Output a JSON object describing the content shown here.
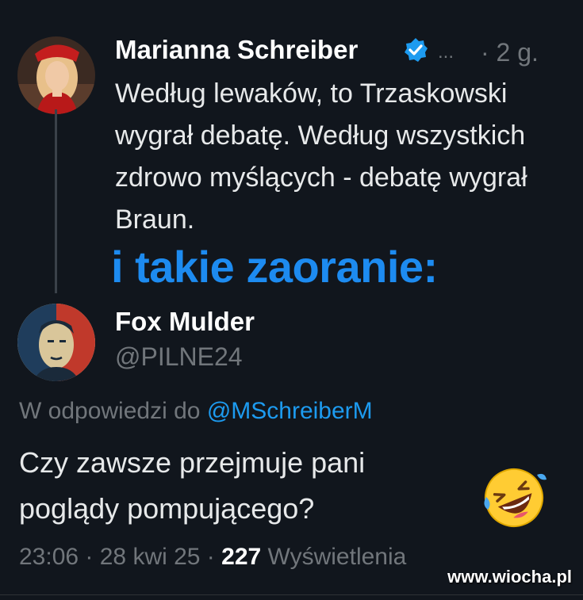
{
  "tweet": {
    "author_name": "Marianna Schreiber",
    "more": "...",
    "age": "· 2 g.",
    "text": "Według lewaków, to Trzaskowski wygrał debatę. Według wszystkich zdrowo myślących - debatę wygrał Braun."
  },
  "caption": "i takie zaoranie:",
  "reply": {
    "author_name": "Fox Mulder",
    "handle": "@PILNE24",
    "replying_prefix": "W odpowiedzi do",
    "replying_mention": "@MSchreiberM",
    "text": "Czy zawsze przejmuje pani poglądy pompującego?",
    "time": "23:06 · 28 kwi 25 ·",
    "views_count": "227",
    "views_label": "Wyświetlenia"
  },
  "watermark": "www.wiocha.pl",
  "icons": {
    "verified": "verified-badge-icon",
    "emoji": "rolling-on-floor-laughing-emoji-icon"
  },
  "colors": {
    "background": "#11161d",
    "link": "#1d9bf0",
    "caption": "#1d8bf0",
    "muted": "#71767b",
    "verified": "#1d9bf0"
  }
}
